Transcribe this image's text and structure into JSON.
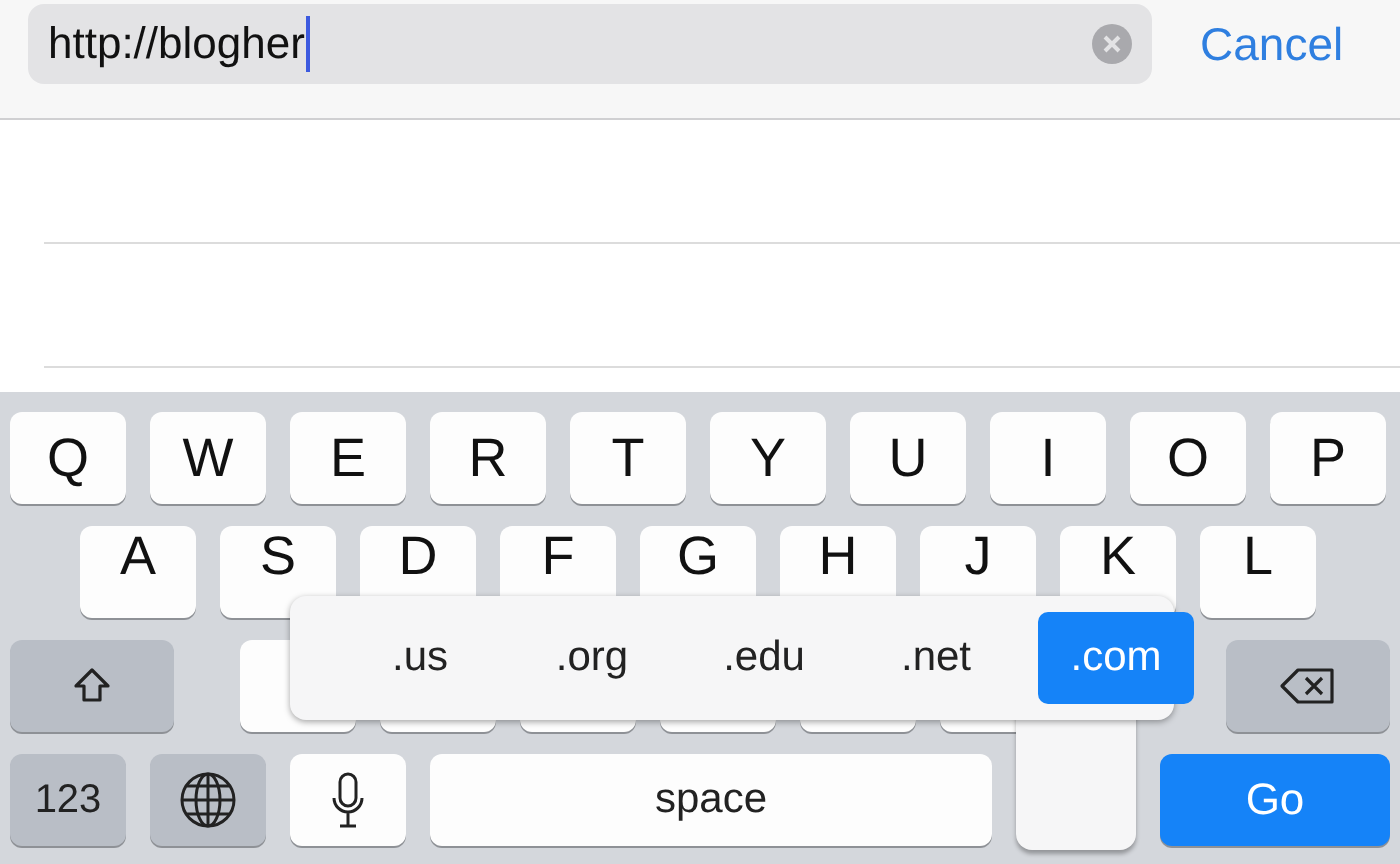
{
  "address_bar": {
    "value": "http://blogher",
    "cancel": "Cancel"
  },
  "keyboard": {
    "row_1": [
      "Q",
      "W",
      "E",
      "R",
      "T",
      "Y",
      "U",
      "I",
      "O",
      "P"
    ],
    "row_2": [
      "A",
      "S",
      "D",
      "F",
      "G",
      "H",
      "J",
      "K",
      "L"
    ],
    "row_4": {
      "numbers": "123",
      "space": "space",
      "go": "Go"
    }
  },
  "domain_popup": [
    {
      "label": ".us",
      "selected": false
    },
    {
      "label": ".org",
      "selected": false
    },
    {
      "label": ".edu",
      "selected": false
    },
    {
      "label": ".net",
      "selected": false
    },
    {
      "label": ".com",
      "selected": true
    }
  ]
}
